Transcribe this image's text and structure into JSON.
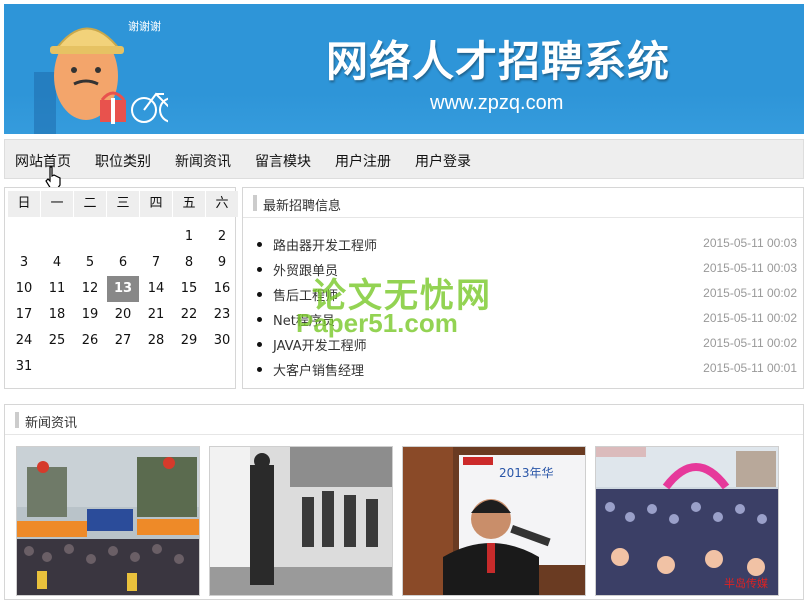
{
  "banner": {
    "title": "网络人才招聘系统",
    "url": "www.zpzq.com",
    "mascot_text": "谢谢谢"
  },
  "nav": [
    "网站首页",
    "职位类别",
    "新闻资讯",
    "留言模块",
    "用户注册",
    "用户登录"
  ],
  "calendar": {
    "weekdays": [
      "日",
      "一",
      "二",
      "三",
      "四",
      "五",
      "六"
    ],
    "weeks": [
      [
        "",
        "",
        "",
        "",
        "",
        "1",
        "2"
      ],
      [
        "3",
        "4",
        "5",
        "6",
        "7",
        "8",
        "9"
      ],
      [
        "10",
        "11",
        "12",
        "13",
        "14",
        "15",
        "16"
      ],
      [
        "17",
        "18",
        "19",
        "20",
        "21",
        "22",
        "23"
      ],
      [
        "24",
        "25",
        "26",
        "27",
        "28",
        "29",
        "30"
      ],
      [
        "31",
        "",
        "",
        "",
        "",
        "",
        ""
      ]
    ],
    "today": "13"
  },
  "jobs": {
    "heading": "最新招聘信息",
    "items": [
      {
        "title": "路由器开发工程师",
        "date": "2015-05-11 00:03"
      },
      {
        "title": "外贸跟单员",
        "date": "2015-05-11 00:03"
      },
      {
        "title": "售后工程师",
        "date": "2015-05-11 00:02"
      },
      {
        "title": "Net程序员",
        "date": "2015-05-11 00:02"
      },
      {
        "title": "JAVA开发工程师",
        "date": "2015-05-11 00:02"
      },
      {
        "title": "大客户销售经理",
        "date": "2015-05-11 00:01"
      }
    ]
  },
  "watermark": {
    "line1": "论文无忧网",
    "line2": "Paper51.com"
  },
  "news": {
    "heading": "新闻资讯",
    "photos": [
      {
        "icon": "job-fair-crowd-photo"
      },
      {
        "icon": "bw-job-fair-photo"
      },
      {
        "icon": "speaker-photo",
        "caption": "2013年华"
      },
      {
        "icon": "crowd-arch-photo",
        "caption": "半岛传媒"
      }
    ]
  },
  "colors": {
    "banner": "#2e95d8",
    "nav_bg": "#eeeeee",
    "today_bg": "#888888",
    "date_text": "#999999",
    "watermark": "#78c828"
  }
}
